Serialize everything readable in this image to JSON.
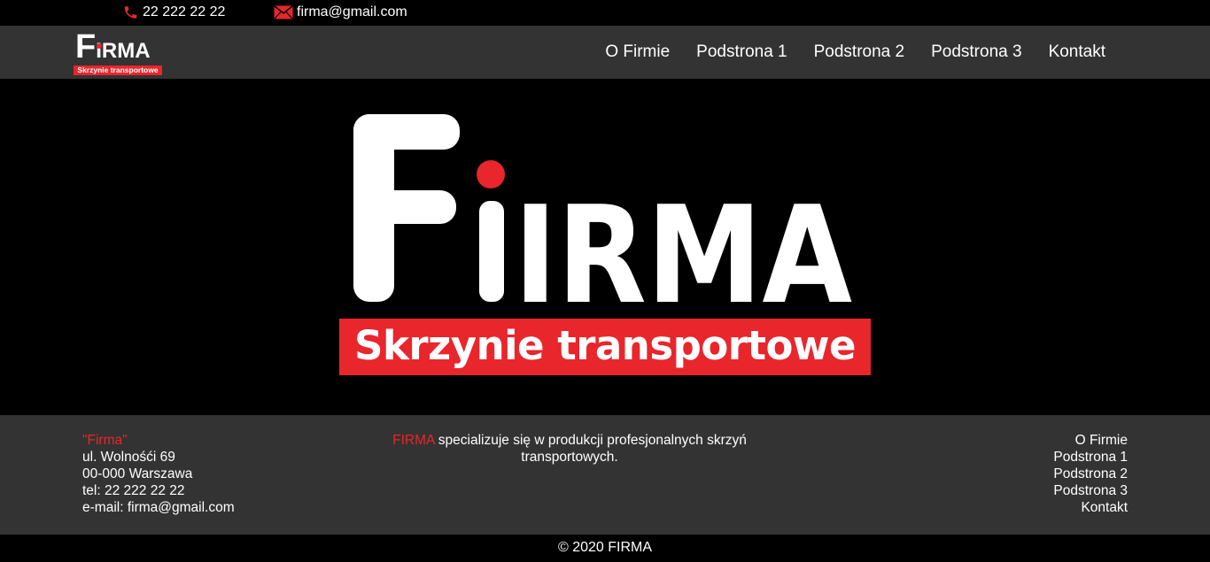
{
  "topbar": {
    "phone": "22 222 22 22",
    "email": "firma@gmail.com",
    "phone_icon": "phone-icon",
    "email_icon": "envelope-icon"
  },
  "brand": {
    "logo_f": "F",
    "logo_rest": "IRMA",
    "tagline": "Skrzynie transportowe"
  },
  "nav": {
    "items": [
      {
        "label": "O Firmie"
      },
      {
        "label": "Podstrona 1"
      },
      {
        "label": "Podstrona 2"
      },
      {
        "label": "Podstrona 3"
      },
      {
        "label": "Kontakt"
      }
    ]
  },
  "footer": {
    "company_name": "\"Firma\"",
    "address_street": "ul. Wolnośći 69",
    "address_city": "00-000 Warszawa",
    "tel": "tel: 22 222 22 22",
    "email": "e-mail: firma@gmail.com",
    "about_brand": "FIRMA",
    "about_text": " specializuje się w produkcji profesjonalnych skrzyń transportowych.",
    "links": [
      {
        "label": "O Firmie"
      },
      {
        "label": "Podstrona 1"
      },
      {
        "label": "Podstrona 2"
      },
      {
        "label": "Podstrona 3"
      },
      {
        "label": "Kontakt"
      }
    ]
  },
  "copyright": "© 2020 FIRMA",
  "colors": {
    "accent": "#e8262c",
    "bar": "#333333",
    "background": "#000000"
  }
}
